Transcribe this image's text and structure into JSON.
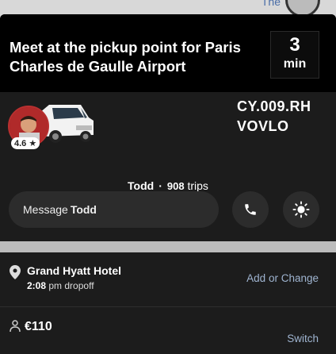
{
  "map": {
    "label": "The"
  },
  "header": {
    "headline": "Meet at the pickup point for Paris Charles de Gaulle Airport",
    "eta_value": "3",
    "eta_unit": "min"
  },
  "driver": {
    "rating": "4.6 ★",
    "plate_line1": "CY.009.RH",
    "plate_line2": "VOVLO",
    "name": "Todd",
    "separator": "·",
    "trips_count": "908",
    "trips_label": "trips"
  },
  "actions": {
    "message_prefix": "Message",
    "message_name": "Todd",
    "phone_icon": "phone-icon",
    "light_icon": "brightness-icon"
  },
  "destination": {
    "name": "Grand Hyatt Hotel",
    "time": "2:08",
    "time_suffix": "pm dropoff",
    "change_label": "Add or Change"
  },
  "fare": {
    "price": "€110",
    "switch_label": "Switch"
  },
  "colors": {
    "header_bg": "#000000",
    "sheet_bg": "#1c1c1c",
    "link": "#9fb4d0",
    "button_bg": "#2c2c2c"
  }
}
